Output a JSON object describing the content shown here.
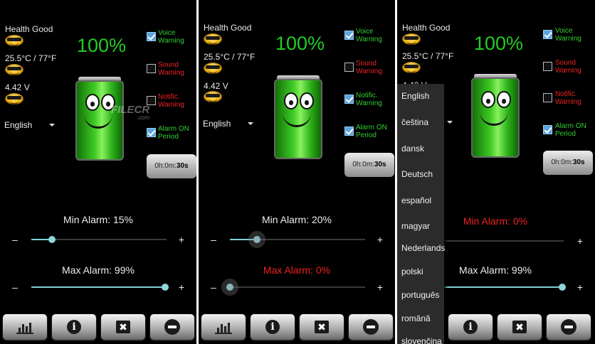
{
  "status": {
    "health": "Health Good",
    "temperature": "25.5°C / 77°F",
    "voltage": "4.42 V"
  },
  "battery_percent": "100%",
  "options": {
    "voice": "Voice Warning",
    "sound": "Sound Warning",
    "notific": "Notific. Warning",
    "alarm_period": "Alarm ON Period"
  },
  "timer": {
    "prefix": "0h:0m:",
    "seconds": "30s"
  },
  "language": {
    "selected": "English"
  },
  "watermark": {
    "text": "FILECR",
    "sub": ".com"
  },
  "colors": {
    "accent_green": "#33cc33",
    "warning_red": "#ee2222",
    "slider": "#7ed0d6"
  },
  "bottom_bar": {
    "stats_icon": "bar-chart-icon",
    "info_icon": "info-icon",
    "close_icon": "close-icon",
    "minimize_icon": "minus-icon",
    "info_glyph": "i",
    "close_glyph": "✖"
  },
  "slider_signs": {
    "minus": "–",
    "plus": "+"
  },
  "screens": [
    {
      "checks": {
        "voice": true,
        "sound": false,
        "notific": false,
        "alarm_period": true
      },
      "min_alarm": {
        "label": "Min Alarm: 15%",
        "value": 15
      },
      "max_alarm": {
        "label": "Max Alarm: 99%",
        "value": 99
      }
    },
    {
      "checks": {
        "voice": true,
        "sound": false,
        "notific": true,
        "alarm_period": true
      },
      "min_alarm": {
        "label": "Min Alarm: 20%",
        "value": 20
      },
      "max_alarm": {
        "label": "Max Alarm: 0%",
        "value": 0
      }
    },
    {
      "checks": {
        "voice": true,
        "sound": false,
        "notific": false,
        "alarm_period": true
      },
      "min_alarm": {
        "label": "Min Alarm: 0%",
        "value": 0
      },
      "max_alarm": {
        "label": "Max Alarm: 99%",
        "value": 99
      }
    }
  ],
  "language_options": [
    "English",
    "čeština",
    "dansk",
    "Deutsch",
    "español",
    "magyar",
    "Nederlands",
    "polski",
    "português",
    "română",
    "slovenčina"
  ]
}
